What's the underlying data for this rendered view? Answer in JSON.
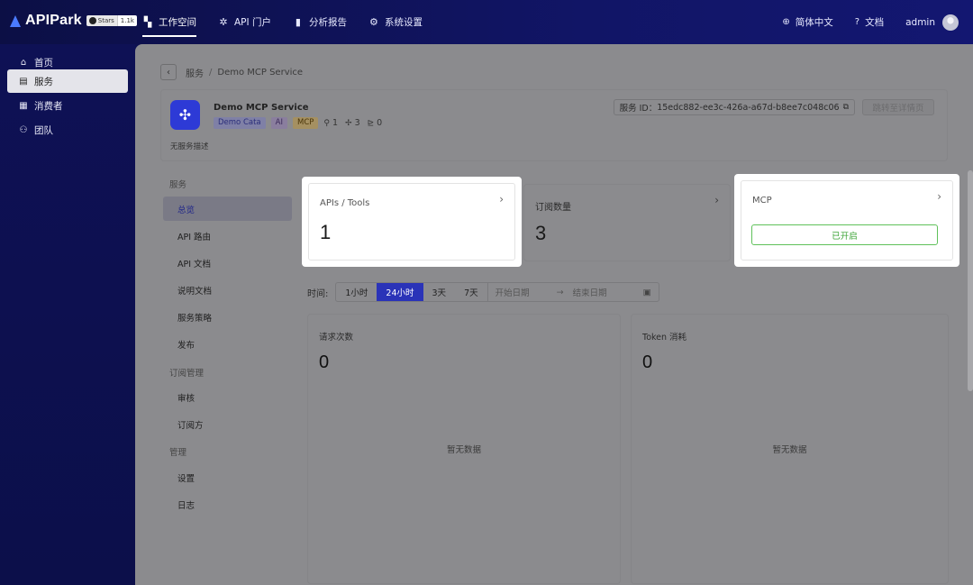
{
  "brand": {
    "name": "APIPark",
    "github_label": "Stars",
    "github_count": "1.1k"
  },
  "nav": [
    {
      "label": "工作空间",
      "icon": "dashboard-icon",
      "active": true
    },
    {
      "label": "API 门户",
      "icon": "network-icon",
      "active": false
    },
    {
      "label": "分析报告",
      "icon": "bar-chart-icon",
      "active": false
    },
    {
      "label": "系统设置",
      "icon": "gear-icon",
      "active": false
    }
  ],
  "top_right": {
    "language": "简体中文",
    "docs": "文档",
    "user": "admin"
  },
  "sidebar": [
    {
      "label": "首页",
      "icon": "home-icon",
      "active": false
    },
    {
      "label": "服务",
      "icon": "service-icon",
      "active": true
    },
    {
      "label": "消费者",
      "icon": "grid-icon",
      "active": false
    },
    {
      "label": "团队",
      "icon": "team-icon",
      "active": false
    }
  ],
  "breadcrumb": {
    "parent": "服务",
    "current": "Demo MCP Service"
  },
  "service": {
    "name": "Demo MCP Service",
    "tags": [
      "Demo Cata",
      "AI",
      "MCP"
    ],
    "api_count": "1",
    "subscriber_count": "3",
    "stat3": "0",
    "description": "无服务描述",
    "id_label": "服务 ID：",
    "id": "15edc882-ee3c-426a-a67d-b8ee7c048c06",
    "detail_button": "跳转至详情页"
  },
  "subnav": {
    "groups": {
      "service": "服务",
      "subscription": "订阅管理",
      "management": "管理"
    },
    "items": {
      "overview": "总览",
      "api_route": "API 路由",
      "api_doc": "API 文档",
      "readme": "说明文档",
      "policy": "服务策略",
      "publish": "发布",
      "review": "审核",
      "subscribers": "订阅方",
      "settings": "设置",
      "logs": "日志"
    }
  },
  "cards": {
    "apis": {
      "label": "APIs / Tools",
      "value": "1"
    },
    "subs": {
      "label": "订阅数量",
      "value": "3"
    },
    "mcp": {
      "label": "MCP",
      "button": "已开启"
    }
  },
  "time_filter": {
    "label": "时间:",
    "options": [
      "1小时",
      "24小时",
      "3天",
      "7天"
    ],
    "selected": "24小时",
    "start_placeholder": "开始日期",
    "end_placeholder": "结束日期"
  },
  "panels": {
    "requests": {
      "title": "请求次数",
      "value": "0",
      "empty": "暂无数据"
    },
    "tokens": {
      "title": "Token 消耗",
      "value": "0",
      "empty": "暂无数据"
    }
  },
  "colors": {
    "accent": "#2a33b8",
    "success": "#3aa334",
    "topbar": "#0d1150"
  }
}
